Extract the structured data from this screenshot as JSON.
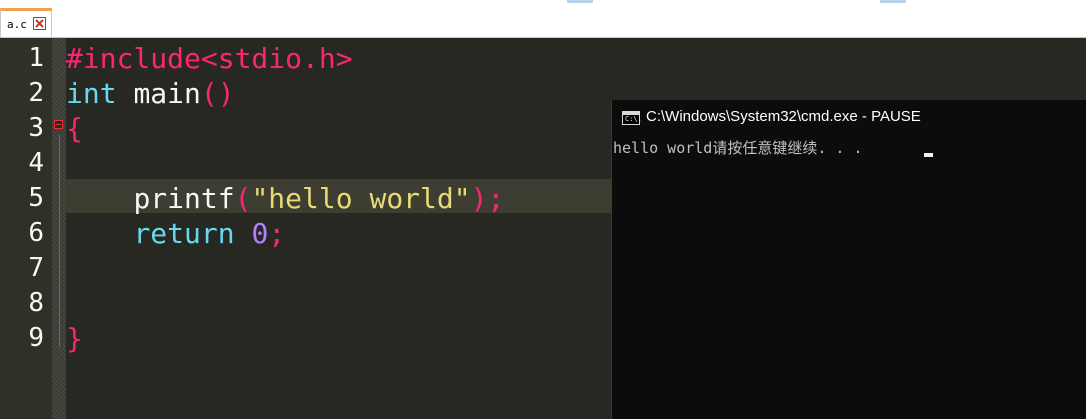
{
  "tab": {
    "filename": "a.c"
  },
  "editor": {
    "line_numbers": [
      "1",
      "2",
      "3",
      "4",
      "5",
      "6",
      "7",
      "8",
      "9"
    ],
    "lines": {
      "l1": {
        "directive": "#include",
        "header": "<stdio.h>"
      },
      "l2": {
        "type": "int",
        "name": "main",
        "parens": "()"
      },
      "l3": {
        "brace": "{"
      },
      "l5": {
        "indent": "    ",
        "func": "printf",
        "open": "(",
        "string": "\"hello world\"",
        "close": ");"
      },
      "l6": {
        "indent": "    ",
        "keyword": "return",
        "number": "0",
        "semi": ";"
      },
      "l9": {
        "brace": "}"
      }
    }
  },
  "console": {
    "title": "C:\\Windows\\System32\\cmd.exe - PAUSE",
    "icon_label": "C:\\.",
    "output": "hello world请按任意键继续. . ."
  }
}
